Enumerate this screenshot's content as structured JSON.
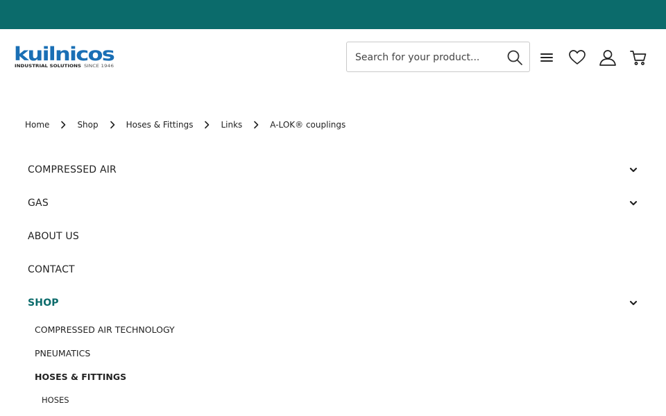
{
  "colors": {
    "topbar": "#0b6b6b",
    "accent": "#0b6b6b",
    "logo_blue": "#1a6fb5"
  },
  "logo": {
    "brand": "kuilnicos",
    "tagline": "INDUSTRIAL SOLUTIONS",
    "since": "SINCE 1946"
  },
  "search": {
    "placeholder": "Search for your product..."
  },
  "header_icons": [
    "menu-icon",
    "heart-icon",
    "user-icon",
    "cart-icon"
  ],
  "breadcrumb": [
    "Home",
    "Shop",
    "Hoses & Fittings",
    "Links",
    "A-LOK® couplings"
  ],
  "menu": [
    {
      "label": "COMPRESSED AIR",
      "expandable": true,
      "active": false
    },
    {
      "label": "GAS",
      "expandable": true,
      "active": false
    },
    {
      "label": "ABOUT US",
      "expandable": false,
      "active": false
    },
    {
      "label": "CONTACT",
      "expandable": false,
      "active": false
    },
    {
      "label": "SHOP",
      "expandable": true,
      "active": true
    }
  ],
  "shop_submenu": [
    {
      "label": "COMPRESSED AIR TECHNOLOGY",
      "bold": false
    },
    {
      "label": "PNEUMATICS",
      "bold": false
    },
    {
      "label": "HOSES & FITTINGS",
      "bold": true
    }
  ],
  "hoses_submenu": [
    "HOSES"
  ]
}
